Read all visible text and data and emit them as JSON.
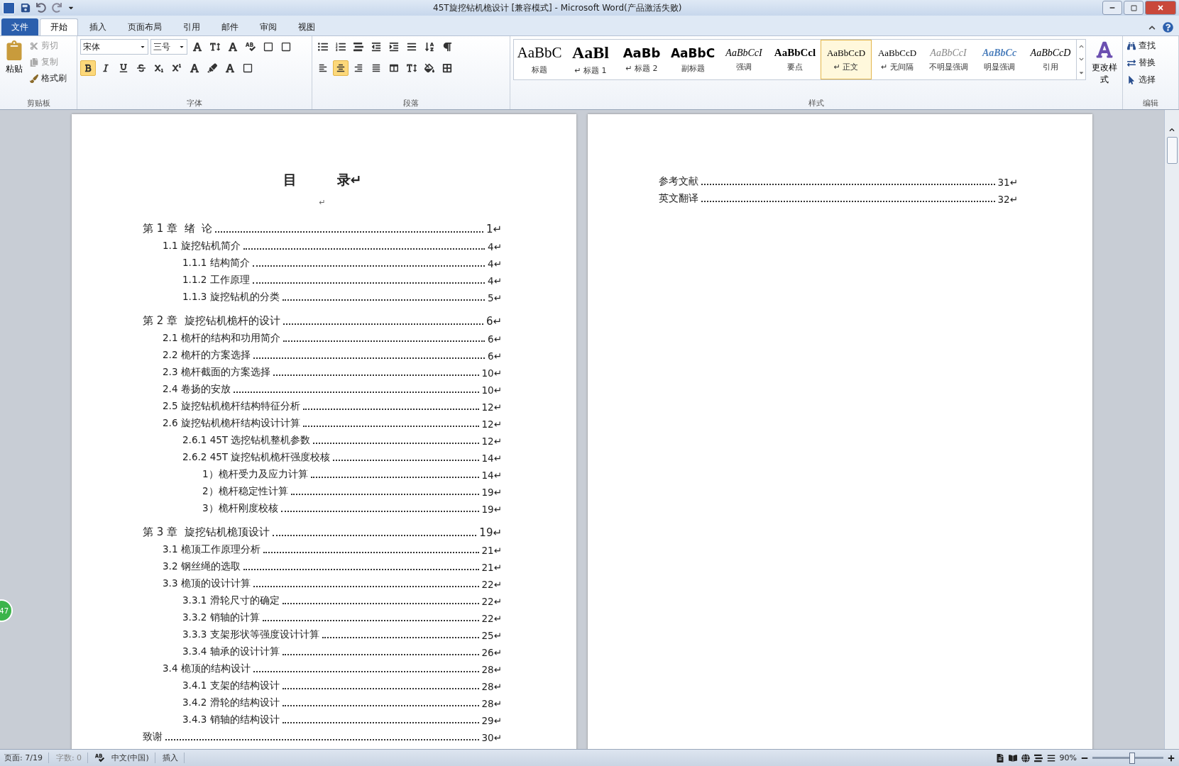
{
  "window": {
    "title": "45T旋挖钻机桅设计 [兼容模式] - Microsoft Word(产品激活失败)"
  },
  "ribbon_tabs": [
    {
      "label": "文件",
      "kind": "file",
      "selected": false
    },
    {
      "label": "开始",
      "kind": "tab",
      "selected": true
    },
    {
      "label": "插入",
      "kind": "tab",
      "selected": false
    },
    {
      "label": "页面布局",
      "kind": "tab",
      "selected": false
    },
    {
      "label": "引用",
      "kind": "tab",
      "selected": false
    },
    {
      "label": "邮件",
      "kind": "tab",
      "selected": false
    },
    {
      "label": "审阅",
      "kind": "tab",
      "selected": false
    },
    {
      "label": "视图",
      "kind": "tab",
      "selected": false
    }
  ],
  "clipboard": {
    "paste": "粘贴",
    "group": "剪贴板",
    "items": [
      {
        "kind": "cut",
        "label": "剪切",
        "disabled": true
      },
      {
        "kind": "copy",
        "label": "复制",
        "disabled": true
      },
      {
        "kind": "brush",
        "label": "格式刷",
        "disabled": false
      }
    ]
  },
  "font": {
    "name": "宋体",
    "size": "三号",
    "group": "字体",
    "format_buttons": [
      {
        "kind": "bold",
        "selected": true
      },
      {
        "kind": "italic",
        "selected": false
      },
      {
        "kind": "underline",
        "selected": false
      },
      {
        "kind": "strike",
        "selected": false
      },
      {
        "kind": "sub",
        "selected": false
      },
      {
        "kind": "sup",
        "selected": false
      }
    ]
  },
  "paragraph": {
    "group": "段落",
    "align_buttons": [
      {
        "kind": "left",
        "selected": false
      },
      {
        "kind": "center",
        "selected": true
      },
      {
        "kind": "right",
        "selected": false
      },
      {
        "kind": "justify",
        "selected": false
      },
      {
        "kind": "distributed",
        "selected": false
      }
    ]
  },
  "styles": {
    "group": "样式",
    "change": "更改样式",
    "items": [
      {
        "preview": "AaBbC",
        "label": "标题",
        "kind": "title",
        "selected": false
      },
      {
        "preview": "AaBl",
        "label": "↵ 标题 1",
        "kind": "h1",
        "selected": false
      },
      {
        "preview": "AaBb",
        "label": "↵ 标题 2",
        "kind": "h2",
        "selected": false
      },
      {
        "preview": "AaBbC",
        "label": "副标题",
        "kind": "subtitle",
        "selected": false
      },
      {
        "preview": "AaBbCcI",
        "label": "强调",
        "kind": "emphasis",
        "selected": false
      },
      {
        "preview": "AaBbCcl",
        "label": "要点",
        "kind": "strong",
        "selected": false
      },
      {
        "preview": "AaBbCcD",
        "label": "↵ 正文",
        "kind": "normal",
        "selected": true
      },
      {
        "preview": "AaBbCcD",
        "label": "↵ 无间隔",
        "kind": "normal",
        "selected": false
      },
      {
        "preview": "AaBbCcI",
        "label": "不明显强调",
        "kind": "subtle",
        "selected": false
      },
      {
        "preview": "AaBbCc",
        "label": "明显强调",
        "kind": "intense",
        "selected": false
      },
      {
        "preview": "AaBbCcD",
        "label": "引用",
        "kind": "quote",
        "selected": false
      }
    ]
  },
  "editing": {
    "group": "编辑",
    "items": [
      {
        "kind": "find",
        "label": "查找"
      },
      {
        "kind": "replace",
        "label": "替换"
      },
      {
        "kind": "select",
        "label": "选择"
      }
    ]
  },
  "pages": [
    {
      "title": "目　　　录↵",
      "blank": "↵",
      "entries": [
        {
          "kind": "chapter",
          "text": "第 1 章  绪  论",
          "page": "1↵",
          "children": [
            {
              "text": "1.1 旋挖钻机简介",
              "page": "4↵",
              "children": [
                {
                  "text": "1.1.1 结构简介",
                  "page": "4↵"
                },
                {
                  "text": "1.1.2 工作原理",
                  "page": "4↵"
                },
                {
                  "text": "1.1.3 旋挖钻机的分类",
                  "page": "5↵"
                }
              ]
            }
          ]
        },
        {
          "kind": "chapter",
          "text": "第 2 章  旋挖钻机桅杆的设计",
          "page": "6↵",
          "children": [
            {
              "text": "2.1 桅杆的结构和功用简介",
              "page": "6↵"
            },
            {
              "text": "2.2 桅杆的方案选择",
              "page": "6↵"
            },
            {
              "text": "2.3 桅杆截面的方案选择",
              "page": "10↵"
            },
            {
              "text": "2.4 卷扬的安放",
              "page": "10↵"
            },
            {
              "text": "2.5 旋挖钻机桅杆结构特征分析",
              "page": "12↵"
            },
            {
              "text": "2.6 旋挖钻机桅杆结构设计计算",
              "page": "12↵",
              "children": [
                {
                  "text": "2.6.1 45T 选挖钻机整机参数",
                  "page": "12↵"
                },
                {
                  "text": "2.6.2 45T 旋挖钻机桅杆强度校核",
                  "page": "14↵",
                  "children": [
                    {
                      "text": "1）桅杆受力及应力计算",
                      "page": "14↵"
                    },
                    {
                      "text": "2）桅杆稳定性计算",
                      "page": "19↵"
                    },
                    {
                      "text": "3）桅杆刚度校核",
                      "page": "19↵"
                    }
                  ]
                }
              ]
            }
          ]
        },
        {
          "kind": "chapter",
          "text": "第 3 章  旋挖钻机桅顶设计",
          "page": "19↵",
          "children": [
            {
              "text": "3.1 桅顶工作原理分析",
              "page": "21↵"
            },
            {
              "text": "3.2 钢丝绳的选取",
              "page": "21↵"
            },
            {
              "text": "3.3 桅顶的设计计算",
              "page": "22↵",
              "children": [
                {
                  "text": "3.3.1 滑轮尺寸的确定",
                  "page": "22↵"
                },
                {
                  "text": "3.3.2 销轴的计算",
                  "page": "22↵"
                },
                {
                  "text": "3.3.3 支架形状等强度设计计算",
                  "page": "25↵"
                },
                {
                  "text": "3.3.4 轴承的设计计算",
                  "page": "26↵"
                }
              ]
            },
            {
              "text": "3.4 桅顶的结构设计",
              "page": "28↵",
              "children": [
                {
                  "text": "3.4.1 支架的结构设计",
                  "page": "28↵"
                },
                {
                  "text": "3.4.2 滑轮的结构设计",
                  "page": "28↵"
                },
                {
                  "text": "3.4.3 销轴的结构设计",
                  "page": "29↵"
                }
              ]
            }
          ]
        },
        {
          "kind": "plain",
          "text": "致谢",
          "page": "30↵"
        }
      ]
    },
    {
      "entries": [
        {
          "kind": "plain",
          "text": "参考文献",
          "page": "31↵"
        },
        {
          "kind": "plain",
          "text": "英文翻译",
          "page": "32↵"
        }
      ]
    }
  ],
  "badge": "47",
  "status_bar": {
    "page": "页面: 7/19",
    "words": "字数: 0",
    "language": "中文(中国)",
    "mode": "插入",
    "zoom": "90%",
    "level": 0.55
  }
}
